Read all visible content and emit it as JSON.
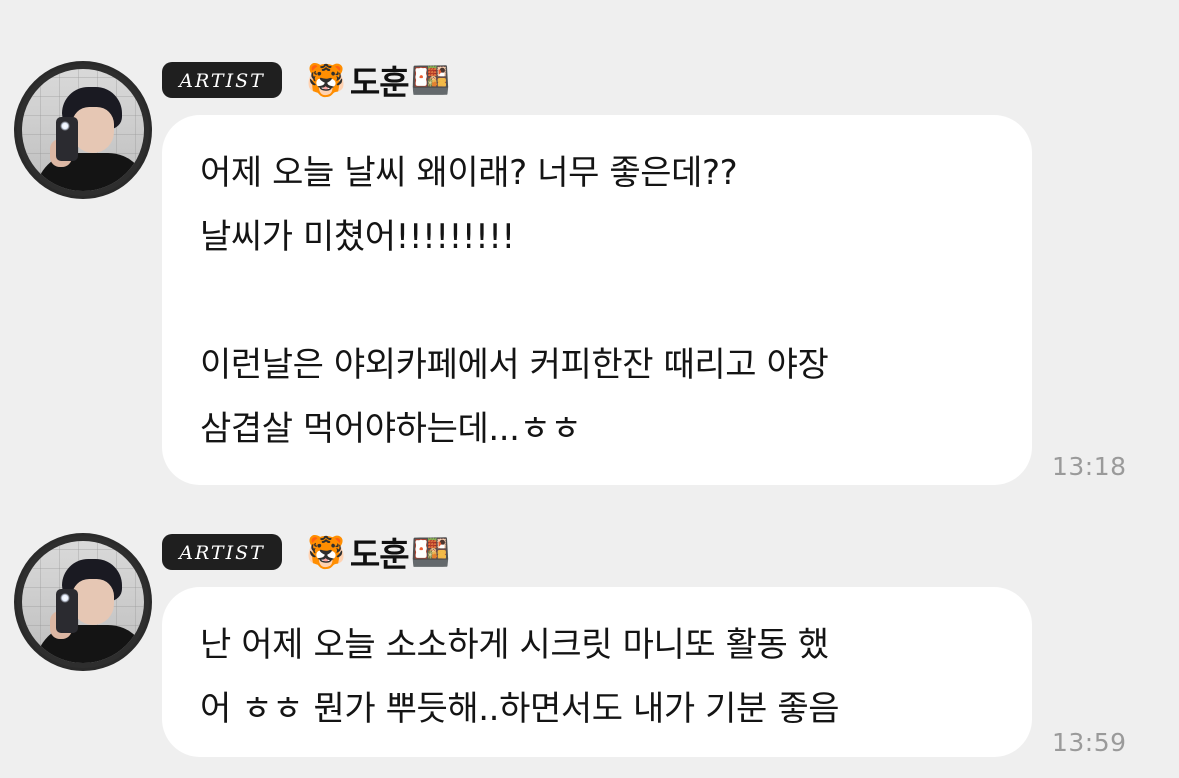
{
  "messages": [
    {
      "badge": "ARTIST",
      "sender_name": "도훈",
      "name_prefix_icon": "🐯",
      "name_suffix_icon": "🍱",
      "text": "어제 오늘 날씨 왜이래? 너무 좋은데??\n날씨가 미쳤어!!!!!!!!!\n\n이런날은 야외카페에서 커피한잔 때리고 야장\n삼겹살 먹어야하는데...ㅎㅎ",
      "time": "13:18"
    },
    {
      "badge": "ARTIST",
      "sender_name": "도훈",
      "name_prefix_icon": "🐯",
      "name_suffix_icon": "🍱",
      "text": "난 어제 오늘 소소하게 시크릿 마니또 활동 했\n어 ㅎㅎ 뭔가 뿌듯해..하면서도 내가 기분 좋음",
      "time": "13:59"
    }
  ]
}
